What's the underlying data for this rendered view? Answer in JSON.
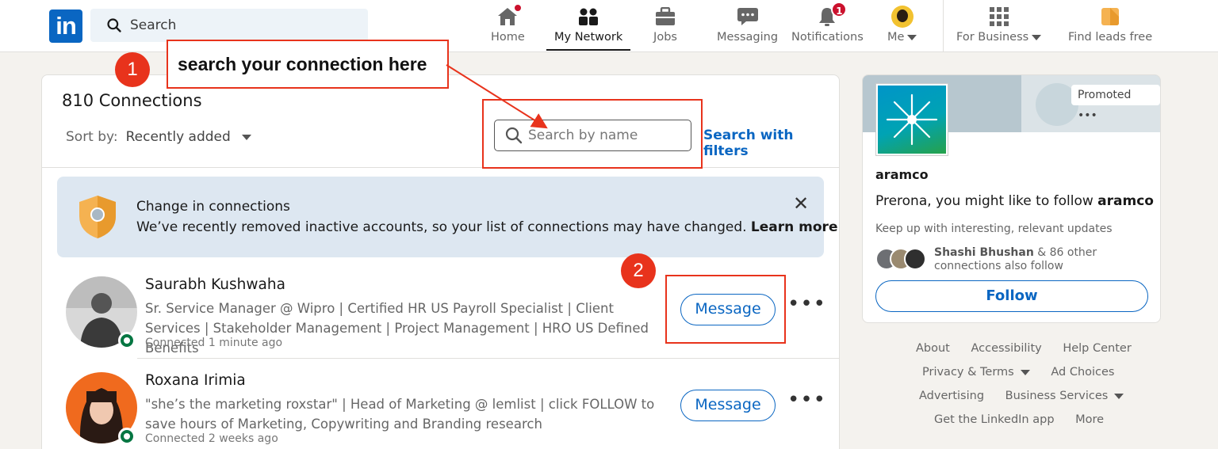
{
  "nav": {
    "search_placeholder": "Search",
    "items": [
      {
        "label": "Home",
        "badge": ""
      },
      {
        "label": "My Network",
        "badge": ""
      },
      {
        "label": "Jobs",
        "badge": ""
      },
      {
        "label": "Messaging",
        "badge": ""
      },
      {
        "label": "Notifications",
        "badge": "1"
      },
      {
        "label": "Me",
        "badge": ""
      },
      {
        "label": "For Business",
        "badge": ""
      },
      {
        "label": "Find leads free",
        "badge": ""
      }
    ],
    "brand_color": "#0a66c2",
    "badge_color": "#cb112d"
  },
  "connections": {
    "count_title": "810 Connections",
    "sort_label": "Sort by:",
    "sort_value": "Recently added",
    "search_placeholder": "Search by name",
    "filters_link": "Search with filters"
  },
  "notice": {
    "title": "Change in connections",
    "body": "We’ve recently removed inactive accounts, so your list of connections may have changed.",
    "link": "Learn more"
  },
  "people": [
    {
      "name": "Saurabh Kushwaha",
      "headline": "Sr. Service Manager @ Wipro | Certified HR US Payroll Specialist | Client Services | Stakeholder Management | Project Management | HRO US Defined Benefits",
      "connected": "Connected 1 minute ago",
      "button": "Message"
    },
    {
      "name": "Roxana Irimia",
      "headline": "\"she’s the marketing roxstar\" | Head of Marketing @ lemlist | click FOLLOW to save hours of Marketing, Copywriting and Branding research",
      "connected": "Connected 2 weeks ago",
      "button": "Message"
    }
  ],
  "ad": {
    "promoted": "Promoted",
    "company": "aramco",
    "pitch_prefix": "Prerona, you might like to follow ",
    "pitch_company": "aramco",
    "sub": "Keep up with interesting, relevant updates",
    "follower_name": "Shashi Bhushan",
    "follower_rest": " & 86 other",
    "follower_line2": "connections also follow",
    "follow_button": "Follow"
  },
  "footer": {
    "row1": [
      "About",
      "Accessibility",
      "Help Center"
    ],
    "row2": [
      "Privacy & Terms",
      "Ad Choices"
    ],
    "row3": [
      "Advertising",
      "Business Services"
    ],
    "row4": [
      "Get the LinkedIn app",
      "More"
    ]
  },
  "annotations": {
    "step1": "1",
    "step2": "2",
    "callout": "search your connection here",
    "color": "#e8331c"
  }
}
